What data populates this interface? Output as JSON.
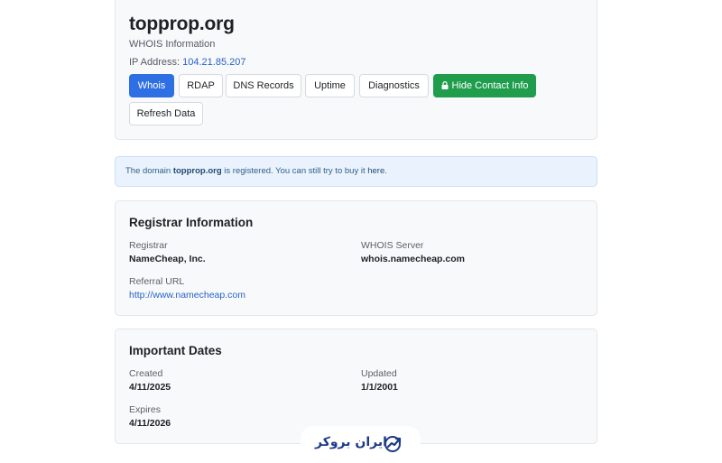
{
  "header": {
    "domain": "topprop.org",
    "subtitle": "WHOIS Information",
    "ip_label": "IP Address:",
    "ip_value": "104.21.85.207"
  },
  "tabs": [
    {
      "label": "Whois",
      "active": true
    },
    {
      "label": "RDAP",
      "active": false
    },
    {
      "label": "DNS Records",
      "active": false
    },
    {
      "label": "Uptime",
      "active": false
    },
    {
      "label": "Diagnostics",
      "active": false
    }
  ],
  "buttons": {
    "hide_contact": "Hide Contact Info",
    "refresh": "Refresh Data"
  },
  "alert": {
    "prefix": "The domain ",
    "domain": "topprop.org",
    "middle": " is registered. You can still try to buy it ",
    "link": "here",
    "suffix": "."
  },
  "registrar": {
    "title": "Registrar Information",
    "registrar_label": "Registrar",
    "registrar_value": "NameCheap, Inc.",
    "whois_server_label": "WHOIS Server",
    "whois_server_value": "whois.namecheap.com",
    "referral_label": "Referral URL",
    "referral_value": "http://www.namecheap.com"
  },
  "dates": {
    "title": "Important Dates",
    "created_label": "Created",
    "created_value": "4/11/2025",
    "updated_label": "Updated",
    "updated_value": "1/1/2001",
    "expires_label": "Expires",
    "expires_value": "4/11/2026"
  },
  "watermark": {
    "text": "ایران بروکر",
    "icon": "trend-chart-icon"
  },
  "colors": {
    "primary": "#2f6fe4",
    "success": "#1f9d4c",
    "link": "#2563c9",
    "alert_bg": "#eaf3fd"
  }
}
